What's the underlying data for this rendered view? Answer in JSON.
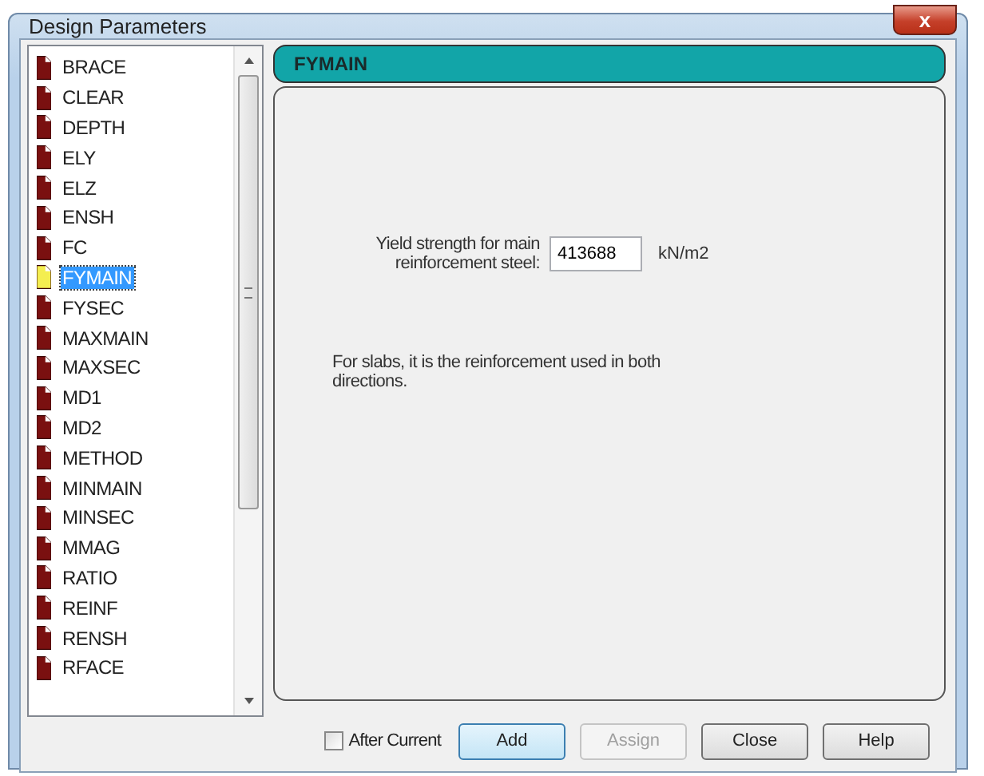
{
  "window": {
    "title": "Design Parameters",
    "close": "x"
  },
  "parameters": [
    {
      "label": "BRACE",
      "selected": false
    },
    {
      "label": "CLEAR",
      "selected": false
    },
    {
      "label": "DEPTH",
      "selected": false
    },
    {
      "label": "ELY",
      "selected": false
    },
    {
      "label": "ELZ",
      "selected": false
    },
    {
      "label": "ENSH",
      "selected": false
    },
    {
      "label": "FC",
      "selected": false
    },
    {
      "label": "FYMAIN",
      "selected": true
    },
    {
      "label": "FYSEC",
      "selected": false
    },
    {
      "label": "MAXMAIN",
      "selected": false
    },
    {
      "label": "MAXSEC",
      "selected": false
    },
    {
      "label": "MD1",
      "selected": false
    },
    {
      "label": "MD2",
      "selected": false
    },
    {
      "label": "METHOD",
      "selected": false
    },
    {
      "label": "MINMAIN",
      "selected": false
    },
    {
      "label": "MINSEC",
      "selected": false
    },
    {
      "label": "MMAG",
      "selected": false
    },
    {
      "label": "RATIO",
      "selected": false
    },
    {
      "label": "REINF",
      "selected": false
    },
    {
      "label": "RENSH",
      "selected": false
    },
    {
      "label": "RFACE",
      "selected": false
    }
  ],
  "panel": {
    "title": "FYMAIN",
    "field_label": "Yield strength for main reinforcement steel:",
    "value": "413688",
    "unit": "kN/m2",
    "description": "For slabs, it is the reinforcement used in both directions."
  },
  "after_current": {
    "label": "After Current",
    "checked": false
  },
  "buttons": [
    {
      "label": "Add",
      "disabled": false,
      "default": true
    },
    {
      "label": "Assign",
      "disabled": true,
      "default": false
    },
    {
      "label": "Close",
      "disabled": false,
      "default": false
    },
    {
      "label": "Help",
      "disabled": false,
      "default": false
    }
  ]
}
